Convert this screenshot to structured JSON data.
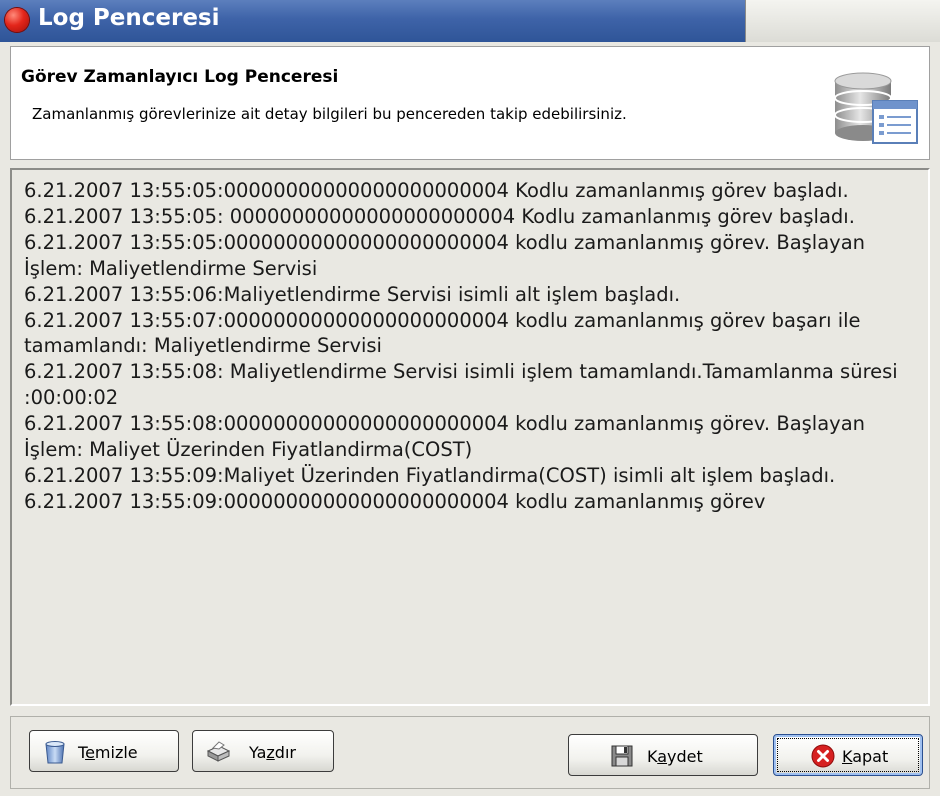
{
  "window": {
    "title": "Log Penceresi"
  },
  "header": {
    "title": "Görev Zamanlayıcı Log Penceresi",
    "description": "Zamanlanmış görevlerinize ait  detay bilgileri bu pencereden takip edebilirsiniz."
  },
  "log": {
    "lines": [
      "6.21.2007 13:55:05:00000000000000000000004 Kodlu zamanlanmış görev başladı.",
      "6.21.2007 13:55:05: 00000000000000000000004 Kodlu zamanlanmış görev başladı.",
      "6.21.2007 13:55:05:00000000000000000000004 kodlu zamanlanmış görev. Başlayan İşlem: Maliyetlendirme Servisi",
      "6.21.2007 13:55:06:Maliyetlendirme Servisi isimli alt işlem başladı.",
      "6.21.2007 13:55:07:00000000000000000000004 kodlu zamanlanmış görev başarı ile tamamlandı: Maliyetlendirme Servisi",
      "6.21.2007 13:55:08: Maliyetlendirme Servisi isimli işlem tamamlandı.Tamamlanma süresi :00:00:02",
      "6.21.2007 13:55:08:00000000000000000000004 kodlu zamanlanmış görev. Başlayan İşlem: Maliyet Üzerinden Fiyatlandirma(COST)",
      "6.21.2007 13:55:09:Maliyet Üzerinden Fiyatlandirma(COST) isimli alt işlem başladı.",
      "6.21.2007 13:55:09:00000000000000000000004 kodlu zamanlanmış görev"
    ]
  },
  "buttons": {
    "clear": {
      "pre": "T",
      "mnemonic": "e",
      "post": "mizle"
    },
    "print": {
      "pre": "Ya",
      "mnemonic": "z",
      "post": "dır"
    },
    "save": {
      "pre": "K",
      "mnemonic": "a",
      "post": "ydet"
    },
    "close": {
      "pre": "",
      "mnemonic": "K",
      "post": "apat"
    }
  },
  "icons": {
    "title": "red-circle-icon",
    "header": "database-list-icon",
    "clear": "trash-bin-icon",
    "print": "printer-icon",
    "save": "floppy-disk-icon",
    "close": "close-circle-icon"
  },
  "colors": {
    "titlebar": "#3e63a8",
    "window_bg": "#e9e8e2",
    "close_icon": "#d62020"
  }
}
